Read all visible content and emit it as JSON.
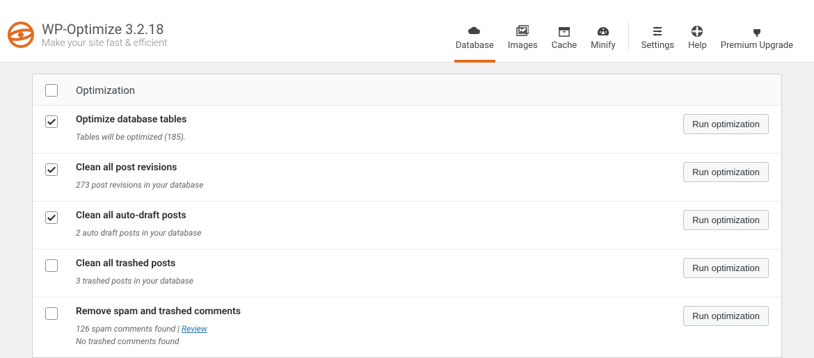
{
  "brand": {
    "title": "WP-Optimize 3.2.18",
    "tagline": "Make your site fast & efficient"
  },
  "nav": {
    "main": [
      {
        "label": "Database",
        "icon": "cloud-icon",
        "active": true
      },
      {
        "label": "Images",
        "icon": "images-icon"
      },
      {
        "label": "Cache",
        "icon": "archive-icon"
      },
      {
        "label": "Minify",
        "icon": "gauge-icon"
      }
    ],
    "secondary": [
      {
        "label": "Settings",
        "icon": "sliders-icon"
      },
      {
        "label": "Help",
        "icon": "help-icon"
      },
      {
        "label": "Premium Upgrade",
        "icon": "plug-icon"
      }
    ]
  },
  "table": {
    "header_label": "Optimization",
    "run_button_label": "Run optimization",
    "review_label": "Review",
    "rows": [
      {
        "title": "Optimize database tables",
        "desc": "Tables will be optimized (185).",
        "checked": true
      },
      {
        "title": "Clean all post revisions",
        "desc": "273 post revisions in your database",
        "checked": true
      },
      {
        "title": "Clean all auto-draft posts",
        "desc": "2 auto draft posts in your database",
        "checked": true
      },
      {
        "title": "Clean all trashed posts",
        "desc": "3 trashed posts in your database",
        "checked": false
      },
      {
        "title": "Remove spam and trashed comments",
        "desc": "126 spam comments found | ",
        "desc2": "No trashed comments found",
        "review": true,
        "checked": false
      }
    ]
  }
}
